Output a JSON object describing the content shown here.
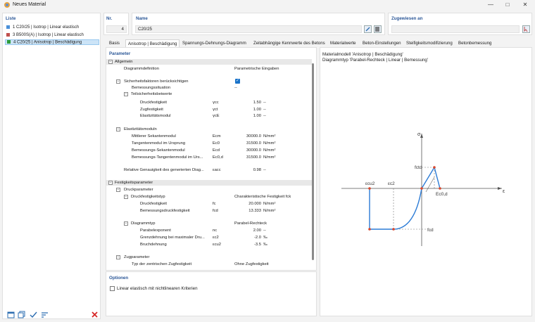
{
  "window": {
    "title": "Neues Material",
    "minimize": "—",
    "maximize": "□",
    "close": "✕"
  },
  "liste": {
    "header": "Liste",
    "items": [
      {
        "label": "1  C20/25 | Isotrop | Linear elastisch",
        "color": "#4a90d9"
      },
      {
        "label": "3  B500S(A) | Isotrop | Linear elastisch",
        "color": "#c0504d"
      },
      {
        "label": "4  C20/25 | Anisotrop | Beschädigung",
        "color": "#2e9d3a"
      }
    ]
  },
  "nr": {
    "label": "Nr.",
    "value": "4"
  },
  "name": {
    "label": "Name",
    "value": "C20/25"
  },
  "zugewiesen": {
    "label": "Zugewiesen an",
    "value": ""
  },
  "tabs": [
    "Basis",
    "Anisotrop | Beschädigung",
    "Spannungs-Dehnungs-Diagramm",
    "Zeitabhängige Kennwerte des Betons",
    "Materialwerte",
    "Beton-Einstellungen",
    "Steifigkeitsmodifizierung",
    "Betonbemessung"
  ],
  "active_tab": 1,
  "parameter": {
    "header": "Parameter",
    "allgemein": "Allgemein",
    "diagrammdef": {
      "label": "Diagrammdefinition",
      "value": "Parametrische Eingaben"
    },
    "sicherheit": {
      "label": "Sicherheitsfaktoren berücksichtigen"
    },
    "bemessungssituation": {
      "label": "Bemessungssituation",
      "value": "--"
    },
    "teilsicherheit": "Teilsicherheitsbeiwerte",
    "gamma_c": {
      "label": "Druckfestigkeit",
      "sym": "γcc",
      "value": "1.50",
      "unit": "--"
    },
    "gamma_ct": {
      "label": "Zugfestigkeit",
      "sym": "γct",
      "value": "1.00",
      "unit": "--"
    },
    "gamma_e": {
      "label": "Elastizitätsmodul",
      "sym": "γcE",
      "value": "1.00",
      "unit": "--"
    },
    "emodul": "Elastizitätsmoduln",
    "ecm": {
      "label": "Mittlerer Sekantenmodul",
      "sym": "Ecm",
      "value": "30000.0",
      "unit": "N/mm²"
    },
    "ec0": {
      "label": "Tangentenmodul im Ursprung",
      "sym": "Ec0",
      "value": "31500.0",
      "unit": "N/mm²"
    },
    "ecd": {
      "label": "Bemessungs-Sekantenmodul",
      "sym": "Ecd",
      "value": "30000.0",
      "unit": "N/mm²"
    },
    "ec0d": {
      "label": "Bemessungs-Tangentenmodul im Urs...",
      "sym": "Ec0,d",
      "value": "31500.0",
      "unit": "N/mm²"
    },
    "genauigkeit": {
      "label": "Relative Genauigkeit des generierten Diag...",
      "sym": "εacc",
      "value": "0.98",
      "unit": "--"
    },
    "festigkeit": "Festigkeitsparameter",
    "druckparameter": "Druckparameter",
    "druckfestigkeitstyp": {
      "label": "Druckfestigkeitstyp",
      "value": "Charakteristische Festigkeit fck"
    },
    "fc": {
      "label": "Druckfestigkeit",
      "sym": "fc",
      "value": "20.000",
      "unit": "N/mm²"
    },
    "fcd": {
      "label": "Bemessungsdruckfestigkeit",
      "sym": "fcd",
      "value": "13.333",
      "unit": "N/mm²"
    },
    "diagrammtyp": {
      "label": "Diagrammtyp",
      "value": "Parabel-Rechteck"
    },
    "nc": {
      "label": "Parabelexponent",
      "sym": "nc",
      "value": "2.00",
      "unit": "--"
    },
    "ec2": {
      "label": "Grenzdehnung bei maximaler Dru...",
      "sym": "εc2",
      "value": "-2.0",
      "unit": "‰"
    },
    "ecu2": {
      "label": "Bruchdehnung",
      "sym": "εcu2",
      "value": "-3.5",
      "unit": "‰"
    },
    "zugparameter": "Zugparameter",
    "zugtyp": {
      "label": "Typ der zentrischen Zugfestigkeit",
      "value": "Ohne Zugfestigkeit"
    }
  },
  "optionen": {
    "header": "Optionen",
    "checkbox": "Linear elastisch mit nichtlinearen Kriterien"
  },
  "chart_info": {
    "line1": "Materialmodell 'Anisotrop | Beschädigung'",
    "line2": "Diagrammtyp 'Parabel-Rechteck | Linear | Bemessung'"
  },
  "chart_labels": {
    "sigma": "σ",
    "eps": "ε",
    "fctd": "fctd",
    "fcd": "fcd",
    "ecu2": "εcu2",
    "ec2": "εc2",
    "ec0d": "Ec0,d"
  },
  "colors": {
    "accent": "#2b5797",
    "curve": "#2b7bd6",
    "point": "#d9472b",
    "selection": "#cce4f7"
  }
}
